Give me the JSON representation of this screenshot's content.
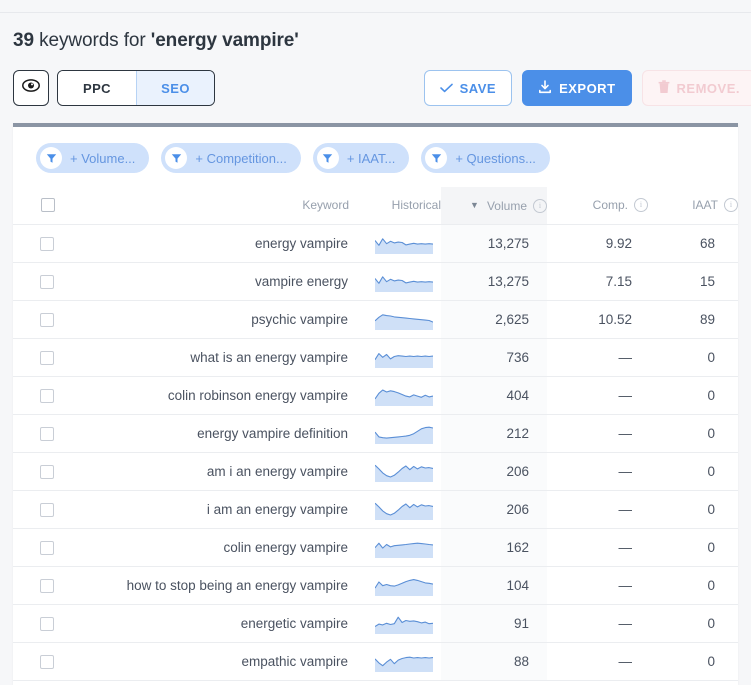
{
  "header": {
    "count": "39",
    "title_middle": " keywords for ",
    "query": "'energy vampire'"
  },
  "toolbar": {
    "eye_icon": "eye-icon",
    "tabs": [
      {
        "label": "PPC",
        "active": false
      },
      {
        "label": "SEO",
        "active": true
      }
    ],
    "save_label": "SAVE",
    "save_icon": "check-icon",
    "export_label": "EXPORT",
    "export_icon": "download-icon",
    "remove_label": "REMOVE.",
    "remove_icon": "trash-icon"
  },
  "filters": [
    {
      "label": "+ Volume...",
      "icon": "filter-funnel-icon"
    },
    {
      "label": "+ Competition...",
      "icon": "filter-funnel-icon"
    },
    {
      "label": "+ IAAT...",
      "icon": "filter-funnel-icon"
    },
    {
      "label": "+ Questions...",
      "icon": "filter-funnel-icon"
    }
  ],
  "table": {
    "columns": {
      "keyword": "Keyword",
      "historical": "Historical",
      "volume": "Volume",
      "comp": "Comp.",
      "iaat": "IAAT"
    },
    "sorted_by": "volume",
    "sort_direction": "desc",
    "rows": [
      {
        "keyword": "energy vampire",
        "volume": "13,275",
        "comp": "9.92",
        "iaat": "68",
        "spark": [
          62,
          38,
          70,
          46,
          58,
          50,
          54,
          52,
          40,
          44,
          48,
          44,
          46,
          44,
          46,
          44
        ]
      },
      {
        "keyword": "vampire energy",
        "volume": "13,275",
        "comp": "7.15",
        "iaat": "15",
        "spark": [
          62,
          38,
          70,
          46,
          58,
          50,
          54,
          52,
          40,
          44,
          48,
          44,
          46,
          44,
          46,
          44
        ]
      },
      {
        "keyword": "psychic vampire",
        "volume": "2,625",
        "comp": "10.52",
        "iaat": "89",
        "spark": [
          40,
          58,
          70,
          66,
          64,
          60,
          58,
          56,
          54,
          52,
          50,
          48,
          46,
          44,
          42,
          34
        ]
      },
      {
        "keyword": "what is an energy vampire",
        "volume": "736",
        "comp": "—",
        "iaat": "0",
        "spark": [
          36,
          66,
          48,
          62,
          40,
          52,
          56,
          54,
          52,
          54,
          52,
          54,
          52,
          54,
          52,
          54
        ]
      },
      {
        "keyword": "colin robinson energy vampire",
        "volume": "404",
        "comp": "—",
        "iaat": "0",
        "spark": [
          30,
          58,
          74,
          64,
          70,
          66,
          60,
          52,
          44,
          40,
          50,
          44,
          38,
          48,
          40,
          44
        ]
      },
      {
        "keyword": "energy vampire definition",
        "volume": "212",
        "comp": "—",
        "iaat": "0",
        "spark": [
          54,
          30,
          26,
          24,
          26,
          28,
          30,
          32,
          34,
          38,
          46,
          58,
          70,
          76,
          78,
          74
        ]
      },
      {
        "keyword": "am i an energy vampire",
        "volume": "206",
        "comp": "—",
        "iaat": "0",
        "spark": [
          78,
          60,
          40,
          26,
          20,
          28,
          44,
          62,
          74,
          56,
          72,
          60,
          70,
          64,
          66,
          62
        ]
      },
      {
        "keyword": "i am an energy vampire",
        "volume": "206",
        "comp": "—",
        "iaat": "0",
        "spark": [
          78,
          60,
          40,
          26,
          20,
          28,
          44,
          62,
          74,
          56,
          72,
          60,
          70,
          64,
          66,
          62
        ]
      },
      {
        "keyword": "colin energy vampire",
        "volume": "162",
        "comp": "—",
        "iaat": "0",
        "spark": [
          46,
          68,
          44,
          62,
          50,
          56,
          58,
          60,
          62,
          64,
          66,
          68,
          66,
          64,
          62,
          60
        ]
      },
      {
        "keyword": "how to stop being an energy vampire",
        "volume": "104",
        "comp": "—",
        "iaat": "0",
        "spark": [
          34,
          64,
          46,
          52,
          46,
          44,
          50,
          58,
          66,
          72,
          76,
          72,
          66,
          60,
          58,
          54
        ]
      },
      {
        "keyword": "energetic vampire",
        "volume": "91",
        "comp": "—",
        "iaat": "0",
        "spark": [
          32,
          44,
          40,
          48,
          42,
          46,
          78,
          52,
          62,
          58,
          60,
          56,
          50,
          54,
          46,
          48
        ]
      },
      {
        "keyword": "empathic vampire",
        "volume": "88",
        "comp": "—",
        "iaat": "0",
        "spark": [
          60,
          40,
          26,
          44,
          58,
          36,
          54,
          62,
          66,
          68,
          64,
          66,
          64,
          66,
          64,
          66
        ]
      }
    ]
  },
  "colors": {
    "accent": "#4b8fe8",
    "chip_bg": "#cfe1fb",
    "spark_fill": "#cfe0f7",
    "spark_line": "#5b8fd6",
    "card_top_border": "#8b95a4"
  }
}
